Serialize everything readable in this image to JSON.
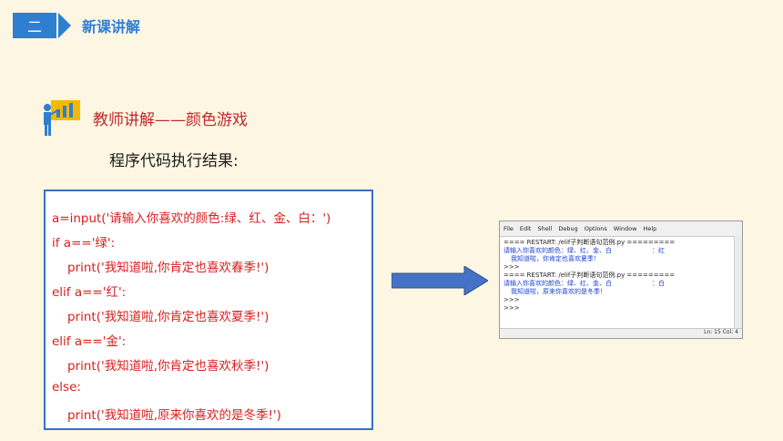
{
  "header": {
    "number": "二",
    "title": "新课讲解"
  },
  "section": {
    "title": "教师讲解——颜色游戏",
    "subtitle": "程序代码执行结果:"
  },
  "code": {
    "lines": [
      "a=input('请输入你喜欢的颜色:绿、红、金、白：')",
      "if a=='绿':",
      "print('我知道啦,你肯定也喜欢春季!')",
      "elif a=='红':",
      "print('我知道啦,你肯定也喜欢夏季!')",
      "elif a=='金':",
      "print('我知道啦,你肯定也喜欢秋季!')",
      "else:",
      "print('我知道啦,原来你喜欢的是冬季!')"
    ]
  },
  "shell": {
    "menu": [
      "File",
      "Edit",
      "Shell",
      "Debug",
      "Options",
      "Window",
      "Help"
    ],
    "lines": [
      "==== RESTART: /elif子判断语句范例.py =========",
      "请输入你喜欢的颜色：绿、红、金、白",
      "：红",
      "我知道啦，你肯定也喜欢夏季！",
      ">>>",
      "==== RESTART: /elif子判断语句范例.py =========",
      "请输入你喜欢的颜色：绿、红、金、白",
      "：白",
      "我知道啦，原来你喜欢的是冬季！",
      ">>>",
      ">>>"
    ],
    "status": "Ln: 15   Col: 4"
  },
  "colors": {
    "accent": "#2f7fd0",
    "code": "#d8201f",
    "title": "#c0282c",
    "arrow": "#4472c4"
  }
}
